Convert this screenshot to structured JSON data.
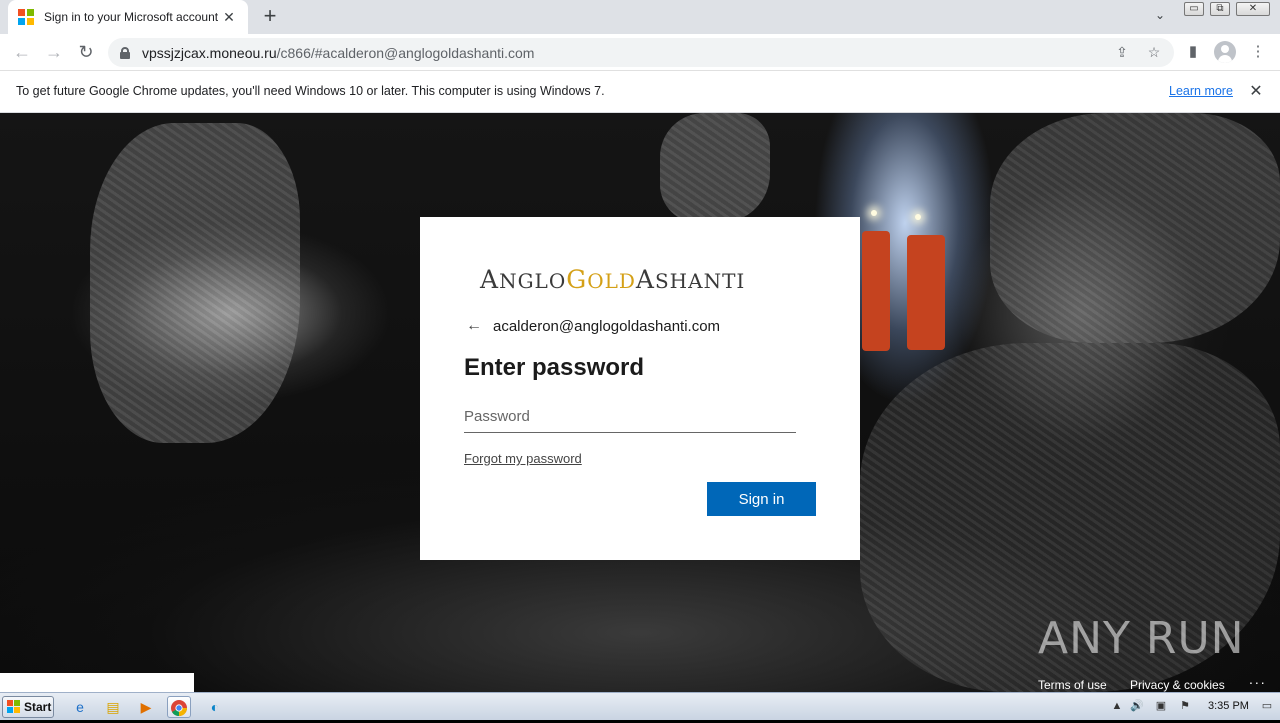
{
  "browser": {
    "tab_title": "Sign in to your Microsoft account",
    "tab_close": "✕",
    "new_tab": "+",
    "tab_search": "⌄",
    "window_controls": [
      "▭",
      "⧉",
      "✕"
    ],
    "url_host": "vpssjzjcax.moneou.ru",
    "url_rest": "/c866/#acalderon@anglogoldashanti.com",
    "nav": {
      "back": "←",
      "forward": "→",
      "reload": "↻"
    },
    "toolbar_icons": {
      "share": "⇪",
      "bookmark": "☆",
      "side_panel": "▮",
      "menu": "⋮"
    }
  },
  "infobar": {
    "message": "To get future Google Chrome updates, you'll need Windows 10 or later. This computer is using Windows 7.",
    "learn_more": "Learn more",
    "close": "✕"
  },
  "login": {
    "brand_parts": [
      "A",
      "NGLO",
      "G",
      "OLD",
      "A",
      "SHANTI"
    ],
    "back_arrow": "←",
    "identity": "acalderon@anglogoldashanti.com",
    "heading": "Enter password",
    "password_placeholder": "Password",
    "password_value": "",
    "forgot": "Forgot my password",
    "signin": "Sign in"
  },
  "footer": {
    "terms": "Terms of use",
    "privacy": "Privacy & cookies",
    "more": "..."
  },
  "watermark": "ANY RUN",
  "taskbar": {
    "start": "Start",
    "clock": "3:35 PM",
    "apps": [
      "ie-icon",
      "explorer-icon",
      "media-player-icon",
      "chrome-icon",
      "edge-icon"
    ],
    "tray": [
      "▲",
      "🔊",
      "▣",
      "⚑",
      "▭"
    ]
  },
  "colors": {
    "ms_red": "#f25022",
    "ms_green": "#7fba00",
    "ms_blue": "#00a4ef",
    "ms_yellow": "#ffb900",
    "signin_blue": "#0067b8",
    "brand_gold": "#d4a017",
    "link_blue": "#1a73e8"
  }
}
